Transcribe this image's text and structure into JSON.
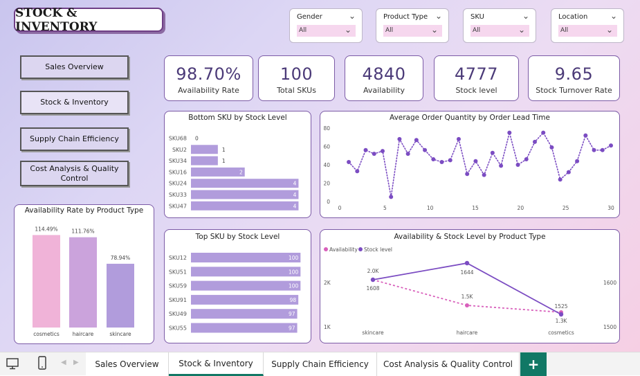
{
  "header": {
    "title": "STOCK & INVENTORY"
  },
  "filters": [
    {
      "label": "Gender",
      "value": "All"
    },
    {
      "label": "Product Type",
      "value": "All"
    },
    {
      "label": "SKU",
      "value": "All"
    },
    {
      "label": "Location",
      "value": "All"
    }
  ],
  "nav": [
    {
      "label": "Sales Overview"
    },
    {
      "label": "Stock & Inventory"
    },
    {
      "label": "Supply Chain Efficiency"
    },
    {
      "label": "Cost Analysis & Quality Control"
    }
  ],
  "kpis": [
    {
      "value": "98.70%",
      "label": "Availability Rate"
    },
    {
      "value": "100",
      "label": "Total SKUs"
    },
    {
      "value": "4840",
      "label": "Availability"
    },
    {
      "value": "4777",
      "label": "Stock level"
    },
    {
      "value": "9.65",
      "label": "Stock Turnover Rate"
    }
  ],
  "tabs": [
    {
      "label": "Sales Overview"
    },
    {
      "label": "Stock & Inventory"
    },
    {
      "label": "Supply Chain Efficiency"
    },
    {
      "label": "Cost Analysis & Quality Control"
    }
  ],
  "colors": {
    "accent": "#b19cdc",
    "purple": "#7b4cc2",
    "pink": "#d85fbb",
    "teal": "#117865"
  },
  "icons": {
    "desktop": "desktop-icon",
    "phone": "phone-icon",
    "prev": "chevron-left-icon",
    "next": "chevron-right-icon",
    "add": "plus-icon",
    "chevron": "chevron-down-icon"
  },
  "chart_data": [
    {
      "id": "bottom-sku",
      "type": "bar",
      "orientation": "horizontal",
      "title": "Bottom SKU by Stock Level",
      "categories": [
        "SKU68",
        "SKU2",
        "SKU34",
        "SKU16",
        "SKU24",
        "SKU33",
        "SKU47"
      ],
      "values": [
        0,
        1,
        1,
        2,
        4,
        4,
        4
      ],
      "xlim": [
        0,
        4.4
      ]
    },
    {
      "id": "avg-order",
      "type": "line",
      "title": "Average Order Quantity by Order Lead Time",
      "x": [
        1,
        2,
        3,
        4,
        5,
        6,
        7,
        8,
        9,
        10,
        11,
        12,
        13,
        14,
        15,
        16,
        17,
        18,
        19,
        20,
        21,
        22,
        23,
        24,
        25,
        26,
        27,
        28,
        29,
        30
      ],
      "y": [
        43,
        33,
        56,
        52,
        55,
        5,
        68,
        52,
        67,
        56,
        46,
        43,
        45,
        68,
        30,
        44,
        29,
        53,
        39,
        75,
        40,
        46,
        65,
        75,
        59,
        24,
        32,
        44,
        72,
        56,
        56,
        61
      ],
      "xticks": [
        0,
        5,
        10,
        15,
        20,
        25,
        30
      ],
      "yticks": [
        0,
        20,
        40,
        60,
        80
      ],
      "xlim": [
        0,
        30
      ],
      "ylim": [
        0,
        80
      ]
    },
    {
      "id": "availability-rate",
      "type": "bar",
      "title": "Availability Rate by Product Type",
      "categories": [
        "cosmetics",
        "haircare",
        "skincare"
      ],
      "values": [
        114.49,
        111.76,
        78.94
      ],
      "labels": [
        "114.49%",
        "111.76%",
        "78.94%"
      ],
      "colors": [
        "#f0b3d8",
        "#cba3dc",
        "#b19cdc"
      ],
      "ylim": [
        0,
        120
      ]
    },
    {
      "id": "top-sku",
      "type": "bar",
      "orientation": "horizontal",
      "title": "Top SKU by Stock Level",
      "categories": [
        "SKU12",
        "SKU51",
        "SKU59",
        "SKU91",
        "SKU49",
        "SKU55"
      ],
      "values": [
        100,
        100,
        100,
        98,
        97,
        97
      ],
      "xlim": [
        0,
        108
      ]
    },
    {
      "id": "avail-stock",
      "type": "line",
      "title": "Availability & Stock Level by Product Type",
      "categories": [
        "skincare",
        "haircare",
        "cosmetics"
      ],
      "series": [
        {
          "name": "Availability",
          "values": [
            1608,
            1500,
            1300
          ],
          "labels": [
            "2.0K",
            "1.5K",
            "1.3K"
          ],
          "style": "dotted",
          "color": "#d85fbb"
        },
        {
          "name": "Stock level",
          "values": [
            1608,
            1644,
            1525
          ],
          "labels": [
            "1608",
            "1644",
            "1525"
          ],
          "style": "solid",
          "color": "#7b4cc2"
        }
      ],
      "left_ticks": [
        "2K",
        "1K"
      ],
      "right_ticks": [
        "1600",
        "1500"
      ]
    }
  ]
}
